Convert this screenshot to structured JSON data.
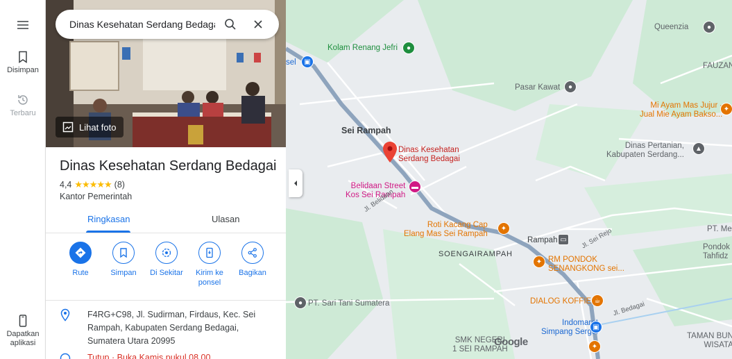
{
  "rail": {
    "items": [
      {
        "label": "Disimpan",
        "icon": "bookmark-icon"
      },
      {
        "label": "Terbaru",
        "icon": "history-icon"
      },
      {
        "label": "Dapatkan aplikasi",
        "icon": "phone-icon"
      }
    ]
  },
  "search": {
    "value": "Dinas Kesehatan Serdang Bedagai"
  },
  "photo": {
    "badge_label": "Lihat foto"
  },
  "place": {
    "title": "Dinas Kesehatan Serdang Bedagai",
    "rating": "4,4",
    "stars": "★★★★★",
    "review_count": "(8)",
    "category": "Kantor Pemerintah"
  },
  "tabs": [
    {
      "label": "Ringkasan",
      "active": true
    },
    {
      "label": "Ulasan",
      "active": false
    }
  ],
  "actions": [
    {
      "label": "Rute",
      "icon": "directions-icon"
    },
    {
      "label": "Simpan",
      "icon": "bookmark-icon"
    },
    {
      "label": "Di Sekitar",
      "icon": "nearby-icon"
    },
    {
      "label": "Kirim ke ponsel",
      "icon": "send-to-phone-icon"
    },
    {
      "label": "Bagikan",
      "icon": "share-icon"
    }
  ],
  "address": "F4RG+C98, Jl. Sudirman, Firdaus, Kec. Sei Rampah, Kabupaten Serdang Bedagai, Sumatera Utara 20995",
  "hours_partial": "Tutup · Buka Kamis pukul 08.00",
  "colors": {
    "accent": "#1a73e8",
    "star": "#fbbc04",
    "pin": "#ea4335",
    "road": "#8ea4bd"
  },
  "map": {
    "labels": {
      "kolam": "Kolam Renang Jefri",
      "sel": "sel",
      "queenzia": "Queenzia",
      "fauzan": "FAUZAN",
      "pasar": "Pasar Kawat",
      "mi_ayam_1": "Mi Ayam Mas Jujur -",
      "mi_ayam_2": "Jual Mie Ayam Bakso...",
      "sei_rampah": "Sei Rampah",
      "pin_1": "Dinas Kesehatan",
      "pin_2": "Serdang Bedagai",
      "dinas_pertanian_1": "Dinas Pertanian,",
      "dinas_pertanian_2": "Kabupaten Serdang...",
      "belidaan_1": "Belidaan Street",
      "belidaan_2": "Kos Sei Rampah",
      "jl_belidaan": "Jl. Belidaan",
      "roti_1": "Roti Kacang Cap",
      "roti_2": "Elang Mas Sei Rampah",
      "rampah": "Rampah",
      "jl_sei_rejo": "Jl. Sei Rejo",
      "pt_me": "PT. Me",
      "pondok_1": "Pondok",
      "pondok_2": "Tahfidz",
      "soengai": "SOENGAIRAMPAH",
      "rm_1": "RM PONDOK",
      "rm_2": "SENANGKONG sei...",
      "pt_sari": "PT. Sari Tani Sumatera",
      "dialog": "DIALOG KOFFIE",
      "indomaret_1": "Indomaret",
      "indomaret_2": "Simpang Sergei",
      "jl_bedagai": "Jl. Bedagai",
      "smk_1": "SMK NEGERI",
      "smk_2": "1 SEI RAMPAH",
      "taman_1": "TAMAN BUN",
      "taman_2": "WISATA",
      "google": "Google"
    }
  }
}
